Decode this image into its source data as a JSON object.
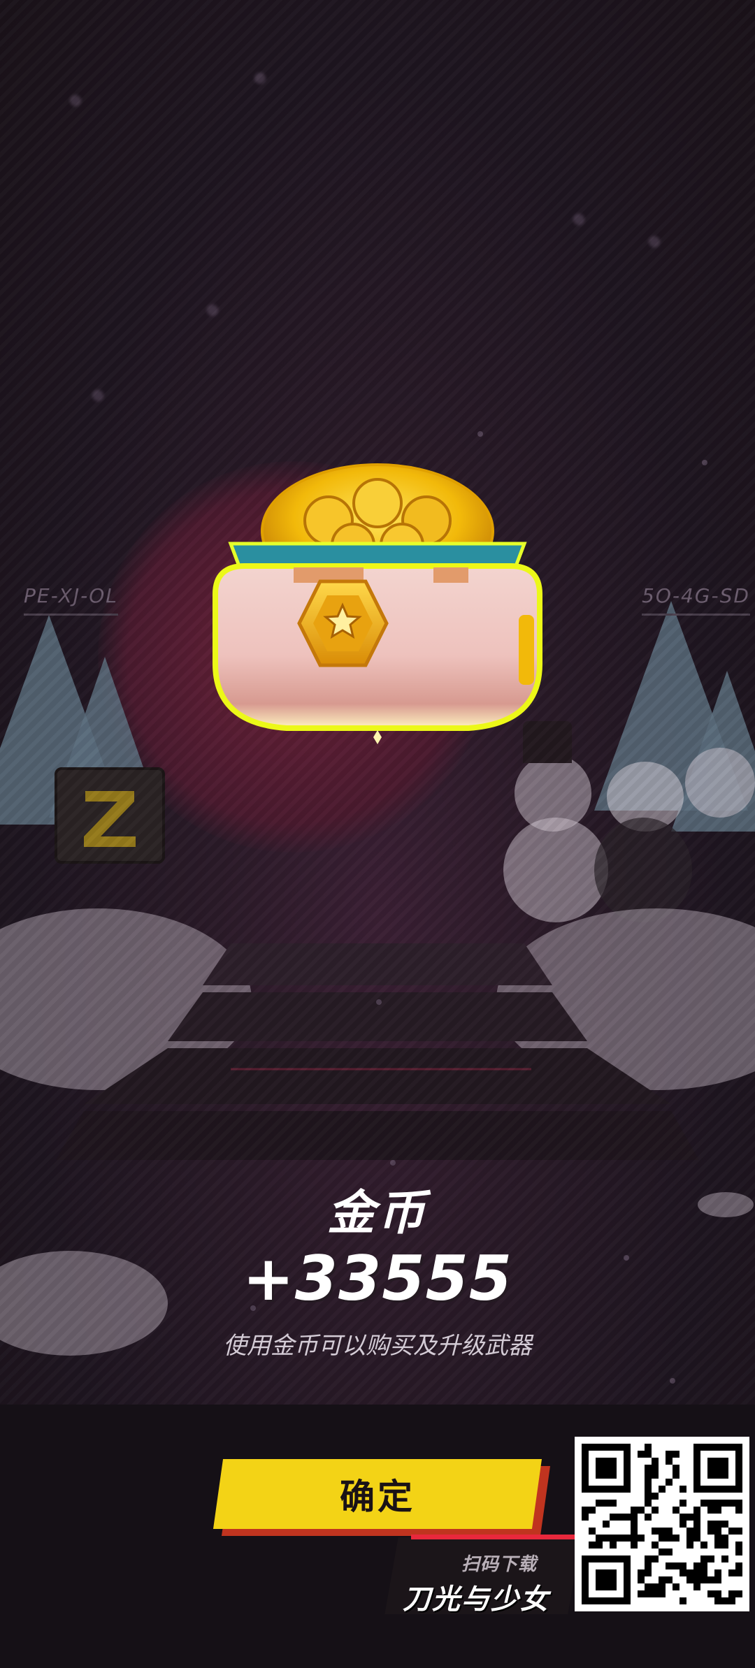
{
  "scene": {
    "left_plate": "PE-XJ-OL",
    "right_plate": "5O-4G-SD"
  },
  "reward": {
    "title": "金币",
    "amount": "+33555",
    "description": "使用金币可以购买及升级武器"
  },
  "actions": {
    "confirm_label": "确定"
  },
  "promo": {
    "scan_text": "扫码下载",
    "game_logo": "刀光与少女"
  },
  "colors": {
    "confirm_button": "#f3d316",
    "confirm_shadow": "#c0341f",
    "accent_line": "#e8283c",
    "coin_gold": "#f2b90a"
  },
  "icons": [
    "coin-chest-icon",
    "star-hex-emblem-icon",
    "qr-code"
  ]
}
